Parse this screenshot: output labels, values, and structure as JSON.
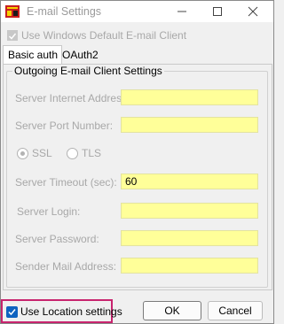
{
  "window": {
    "title": "E-mail Settings"
  },
  "default_client": {
    "label": "Use Windows Default E-mail Client",
    "checked": true,
    "disabled": true
  },
  "tabs": [
    {
      "label": "Basic auth",
      "active": true
    },
    {
      "label": "OAuth2",
      "active": false
    }
  ],
  "group": {
    "title": "Outgoing E-mail Client Settings",
    "server_address": {
      "label": "Server Internet Address:",
      "value": ""
    },
    "server_port": {
      "label": "Server Port Number:",
      "value": ""
    },
    "ssl": {
      "label": "SSL",
      "selected": true
    },
    "tls": {
      "label": "TLS",
      "selected": false
    },
    "timeout": {
      "label": "Server Timeout (sec):",
      "value": "60"
    },
    "login": {
      "label": "Server Login:",
      "value": ""
    },
    "password": {
      "label": "Server Password:",
      "value": ""
    },
    "sender": {
      "label": "Sender Mail Address:",
      "value": ""
    }
  },
  "footer": {
    "location_label": "Use Location settings",
    "location_checked": true,
    "ok_label": "OK",
    "cancel_label": "Cancel"
  },
  "colors": {
    "field_bg": "#ffff99",
    "highlight_border": "#c8246e",
    "checkbox_accent": "#0f63c0"
  }
}
